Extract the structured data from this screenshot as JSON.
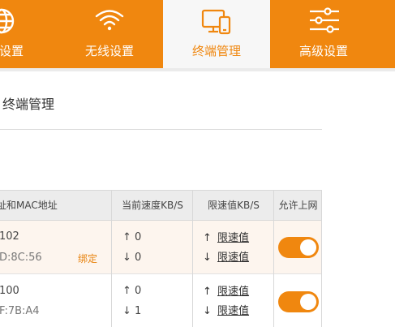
{
  "nav": {
    "tabs": [
      {
        "label": "设置",
        "icon": "globe-icon"
      },
      {
        "label": "无线设置",
        "icon": "wifi-icon"
      },
      {
        "label": "终端管理",
        "icon": "devices-icon",
        "active": true
      },
      {
        "label": "高级设置",
        "icon": "sliders-icon"
      }
    ]
  },
  "page": {
    "title": "终端管理"
  },
  "table": {
    "headers": [
      "址和MAC地址",
      "当前速度KB/S",
      "限速值KB/S",
      "允许上网"
    ],
    "rows": [
      {
        "ip": "102",
        "mac": "D:8C:56",
        "bind_label": "绑定",
        "up_speed": "↑ 0",
        "down_speed": "↓ 0",
        "up_arrow": "↑",
        "down_arrow": "↓",
        "up_limit": "限速值",
        "down_limit": "限速值",
        "allow": true
      },
      {
        "ip": "100",
        "mac": "F:7B:A4",
        "up_speed": "↑ 0",
        "down_speed": "↓ 1",
        "up_arrow": "↑",
        "down_arrow": "↓",
        "up_limit": "限速值",
        "down_limit": "限速值",
        "allow": true
      }
    ]
  },
  "colors": {
    "accent": "#f0870f",
    "nav_active_bg": "#f7f7f7",
    "header_bg": "#ececec",
    "row_highlight": "#fdf5ee"
  }
}
